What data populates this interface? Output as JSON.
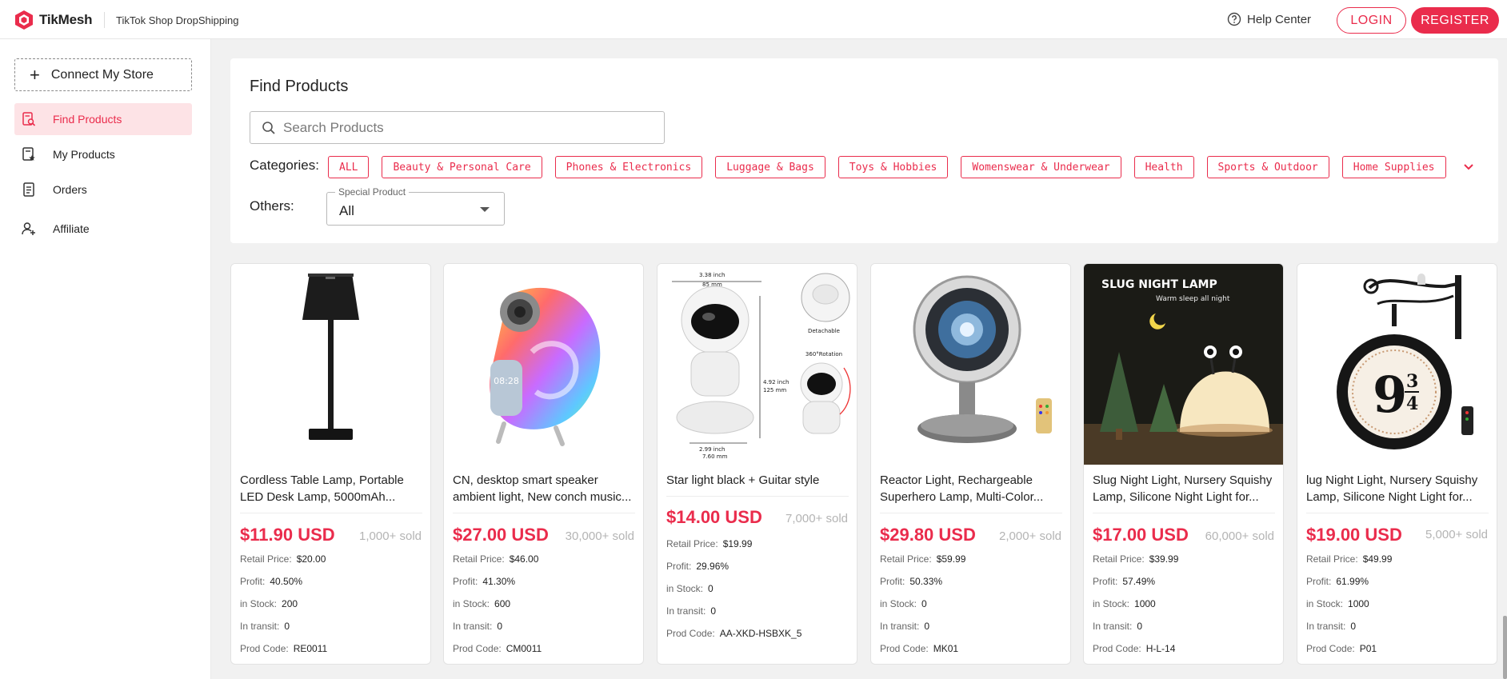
{
  "app": {
    "brand": "TikMesh",
    "subtitle": "TikTok Shop DropShipping"
  },
  "header": {
    "help": "Help Center",
    "login": "LOGIN",
    "register": "REGISTER"
  },
  "sidebar": {
    "connect": "Connect My Store",
    "items": [
      {
        "label": "Find Products",
        "icon": "find-products-icon",
        "active": true
      },
      {
        "label": "My Products",
        "icon": "my-products-icon",
        "active": false
      },
      {
        "label": "Orders",
        "icon": "orders-icon",
        "active": false
      },
      {
        "label": "Affiliate",
        "icon": "affiliate-icon",
        "active": false
      }
    ]
  },
  "filters": {
    "title": "Find Products",
    "search_placeholder": "Search Products",
    "categories_label": "Categories:",
    "categories": [
      "ALL",
      "Beauty & Personal Care",
      "Phones & Electronics",
      "Luggage & Bags",
      "Toys & Hobbies",
      "Womenswear & Underwear",
      "Health",
      "Sports & Outdoor",
      "Home Supplies"
    ],
    "others_label": "Others:",
    "special_legend": "Special Product",
    "special_value": "All"
  },
  "labels": {
    "retail": "Retail Price:",
    "profit": "Profit:",
    "stock": "in Stock:",
    "transit": "In transit:",
    "code": "Prod Code:"
  },
  "products": [
    {
      "name": "Cordless Table Lamp, Portable LED Desk Lamp, 5000mAh...",
      "price": "$11.90 USD",
      "sold": "1,000+ sold",
      "retail": "$20.00",
      "profit": "40.50%",
      "stock": "200",
      "transit": "0",
      "code": "RE0011",
      "image": "table-lamp"
    },
    {
      "name": "CN, desktop smart speaker ambient light, New conch music...",
      "price": "$27.00 USD",
      "sold": "30,000+ sold",
      "retail": "$46.00",
      "profit": "41.30%",
      "stock": "600",
      "transit": "0",
      "code": "CM0011",
      "image": "conch-speaker"
    },
    {
      "name": "Star light black + Guitar style",
      "price": "$14.00 USD",
      "sold": "7,000+ sold",
      "retail": "$19.99",
      "profit": "29.96%",
      "stock": "0",
      "transit": "0",
      "code": "AA-XKD-HSBXK_5",
      "image": "astronaut-projector"
    },
    {
      "name": "Reactor Light, Rechargeable Superhero Lamp, Multi-Color...",
      "price": "$29.80 USD",
      "sold": "2,000+ sold",
      "retail": "$59.99",
      "profit": "50.33%",
      "stock": "0",
      "transit": "0",
      "code": "MK01",
      "image": "reactor-lamp"
    },
    {
      "name": "Slug Night Light, Nursery Squishy Lamp, Silicone Night Light for...",
      "price": "$17.00 USD",
      "sold": "60,000+ sold",
      "retail": "$39.99",
      "profit": "57.49%",
      "stock": "1000",
      "transit": "0",
      "code": "H-L-14",
      "image": "slug-lamp"
    },
    {
      "name": "lug Night Light, Nursery Squishy Lamp, Silicone Night Light for...",
      "price": "$19.00 USD",
      "sold": "5,000+ sold",
      "retail": "$49.99",
      "profit": "61.99%",
      "stock": "1000",
      "transit": "0",
      "code": "P01",
      "image": "station-clock"
    }
  ],
  "slug_image_text": {
    "title": "SLUG NIGHT LAMP",
    "tagline": "Warm sleep all night"
  },
  "astronaut_image_text": {
    "width_in": "3.38 inch",
    "width_cm": "85 mm",
    "height_in": "4.92 inch",
    "height_cm": "125 mm",
    "base_in": "2.99 inch",
    "base_cm": "7.60 mm",
    "detachable": "Detachable",
    "rotation": "360°Rotation"
  },
  "clock_image_text": {
    "numeral": "9",
    "fraction_top": "3",
    "fraction_bottom": "4"
  },
  "colors": {
    "accent": "#ea2c4c",
    "active_bg": "#fde3e6"
  }
}
